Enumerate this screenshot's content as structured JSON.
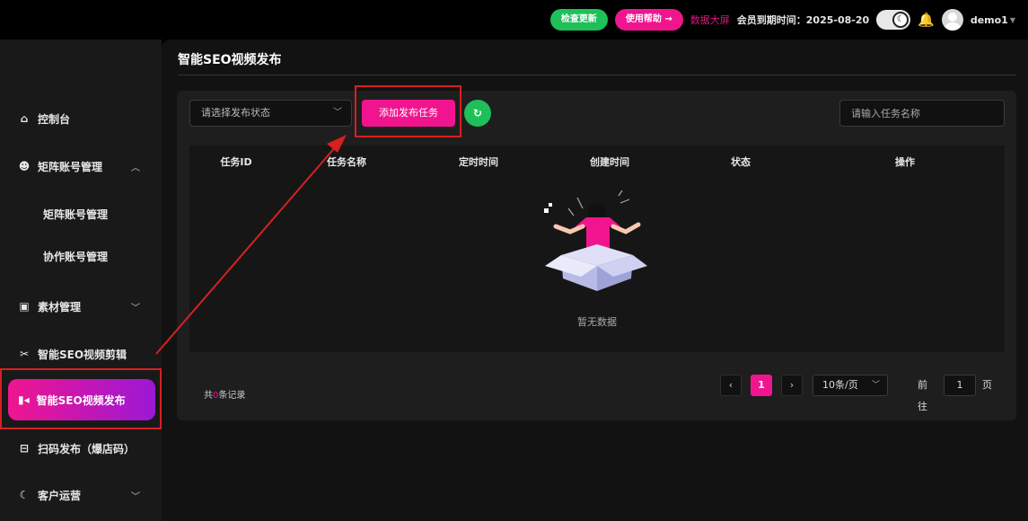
{
  "topbar": {
    "check_update": "检查更新",
    "help": "使用帮助 →",
    "data_screen": "数据大屏",
    "member_expire": "会员到期时间：2025-08-20",
    "username": "demo1"
  },
  "sidebar": {
    "items": [
      {
        "label": "控制台",
        "icon": "home-icon"
      },
      {
        "label": "矩阵账号管理",
        "icon": "account-icon"
      },
      {
        "label": "矩阵账号管理",
        "icon": ""
      },
      {
        "label": "协作账号管理",
        "icon": ""
      },
      {
        "label": "素材管理",
        "icon": "folder-icon"
      },
      {
        "label": "智能SEO视频剪辑",
        "icon": "scissors-icon"
      },
      {
        "label": "智能SEO视频发布",
        "icon": "video-icon"
      },
      {
        "label": "扫码发布（爆店码）",
        "icon": "qrcode-icon"
      },
      {
        "label": "客户运营",
        "icon": "customer-icon"
      }
    ]
  },
  "main": {
    "page_title": "智能SEO视频发布",
    "status_select_placeholder": "请选择发布状态",
    "add_task": "添加发布任务",
    "search_placeholder": "请输入任务名称",
    "columns": [
      "任务ID",
      "任务名称",
      "定时时间",
      "创建时间",
      "状态",
      "操作"
    ],
    "empty_text": "暂无数据",
    "total_prefix": "共",
    "total_count": "0",
    "total_suffix": "条记录",
    "pager": {
      "current_page": "1",
      "page_size": "10条/页",
      "goto_prefix": "前往",
      "goto_value": "1",
      "goto_suffix": "页"
    }
  },
  "colors": {
    "accent_pink": "#f0158f",
    "accent_green": "#1fbf5a",
    "highlight_red": "#d82020"
  }
}
